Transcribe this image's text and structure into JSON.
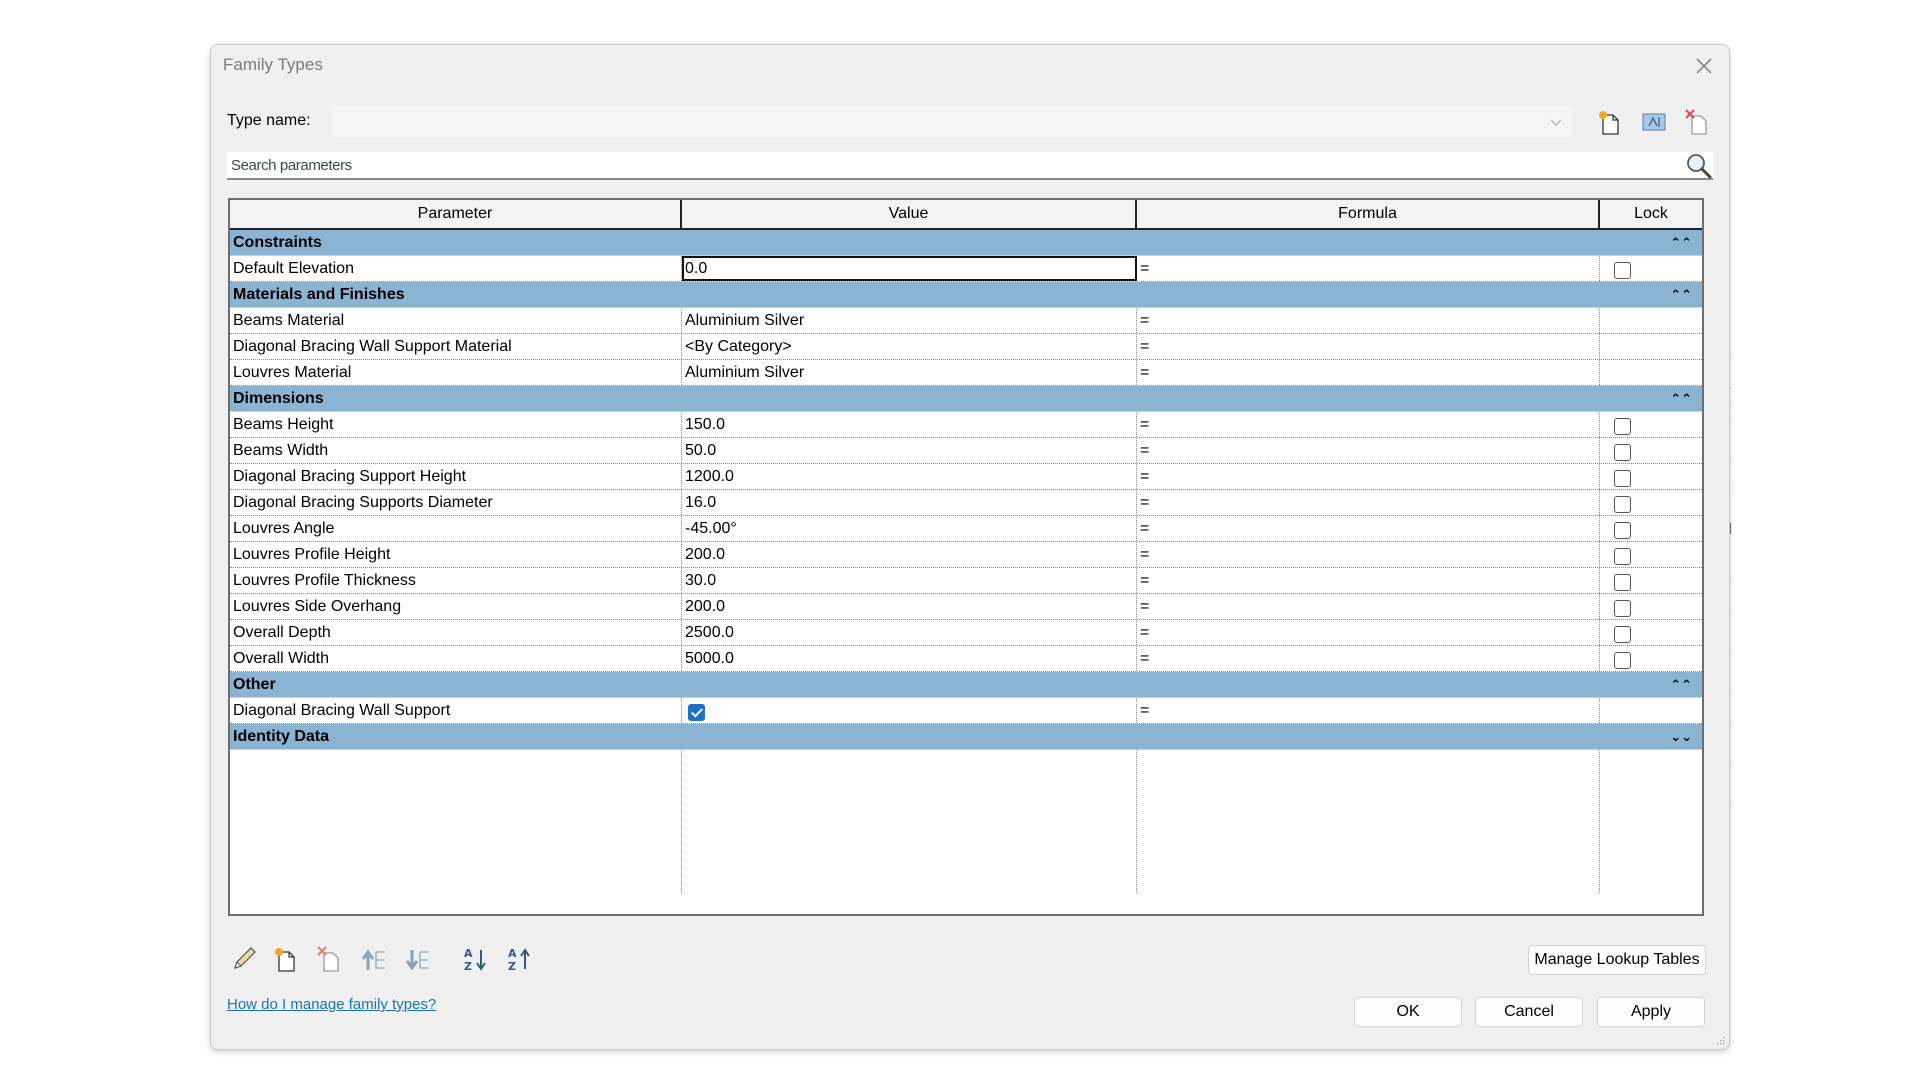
{
  "dialog": {
    "title": "Family Types",
    "type_name_label": "Type name:",
    "type_name_value": "",
    "search_placeholder": "Search parameters"
  },
  "table": {
    "columns": [
      "Parameter",
      "Value",
      "Formula",
      "Lock"
    ],
    "groups": [
      {
        "name": "Constraints",
        "expanded": true,
        "rows": [
          {
            "parameter": "Default Elevation",
            "value": "0.0",
            "formula": "=",
            "lock": "unchecked",
            "active": true
          }
        ]
      },
      {
        "name": "Materials and Finishes",
        "expanded": true,
        "rows": [
          {
            "parameter": "Beams Material",
            "value": "Aluminium Silver",
            "formula": "=",
            "lock": "none"
          },
          {
            "parameter": "Diagonal Bracing Wall Support Material",
            "value": "<By Category>",
            "formula": "=",
            "lock": "none"
          },
          {
            "parameter": "Louvres Material",
            "value": "Aluminium Silver",
            "formula": "=",
            "lock": "none"
          }
        ]
      },
      {
        "name": "Dimensions",
        "expanded": true,
        "rows": [
          {
            "parameter": "Beams Height",
            "value": "150.0",
            "formula": "=",
            "lock": "unchecked"
          },
          {
            "parameter": "Beams Width",
            "value": "50.0",
            "formula": "=",
            "lock": "unchecked"
          },
          {
            "parameter": "Diagonal Bracing Support Height",
            "value": "1200.0",
            "formula": "=",
            "lock": "unchecked"
          },
          {
            "parameter": "Diagonal Bracing Supports Diameter",
            "value": "16.0",
            "formula": "=",
            "lock": "unchecked"
          },
          {
            "parameter": "Louvres Angle",
            "value": "-45.00°",
            "formula": "=",
            "lock": "unchecked"
          },
          {
            "parameter": "Louvres Profile Height",
            "value": "200.0",
            "formula": "=",
            "lock": "unchecked"
          },
          {
            "parameter": "Louvres Profile Thickness",
            "value": "30.0",
            "formula": "=",
            "lock": "unchecked"
          },
          {
            "parameter": "Louvres Side Overhang",
            "value": "200.0",
            "formula": "=",
            "lock": "unchecked"
          },
          {
            "parameter": "Overall Depth",
            "value": "2500.0",
            "formula": "=",
            "lock": "unchecked"
          },
          {
            "parameter": "Overall Width",
            "value": "5000.0",
            "formula": "=",
            "lock": "unchecked"
          }
        ]
      },
      {
        "name": "Other",
        "expanded": true,
        "rows": [
          {
            "parameter": "Diagonal Bracing Wall Support",
            "value_checkbox": true,
            "value": "",
            "formula": "=",
            "lock": "none"
          }
        ]
      },
      {
        "name": "Identity Data",
        "expanded": false,
        "rows": []
      }
    ],
    "toggle_expanded": "⌃⌃",
    "toggle_collapsed": "⌄⌄"
  },
  "toolbar_icons": [
    "edit-parameter-icon",
    "new-parameter-icon",
    "delete-parameter-icon",
    "move-up-icon",
    "move-down-icon",
    "sort-ascending-icon",
    "sort-descending-icon"
  ],
  "footer": {
    "help_link": "How do I manage family types?",
    "manage_lookup_tables": "Manage Lookup Tables",
    "ok": "OK",
    "cancel": "Cancel",
    "apply": "Apply"
  },
  "colors": {
    "group_header": "#8bb3d2",
    "dialog_bg": "#f0f0f0",
    "link": "#1a73b8",
    "checkbox_checked": "#1f6fc4"
  }
}
